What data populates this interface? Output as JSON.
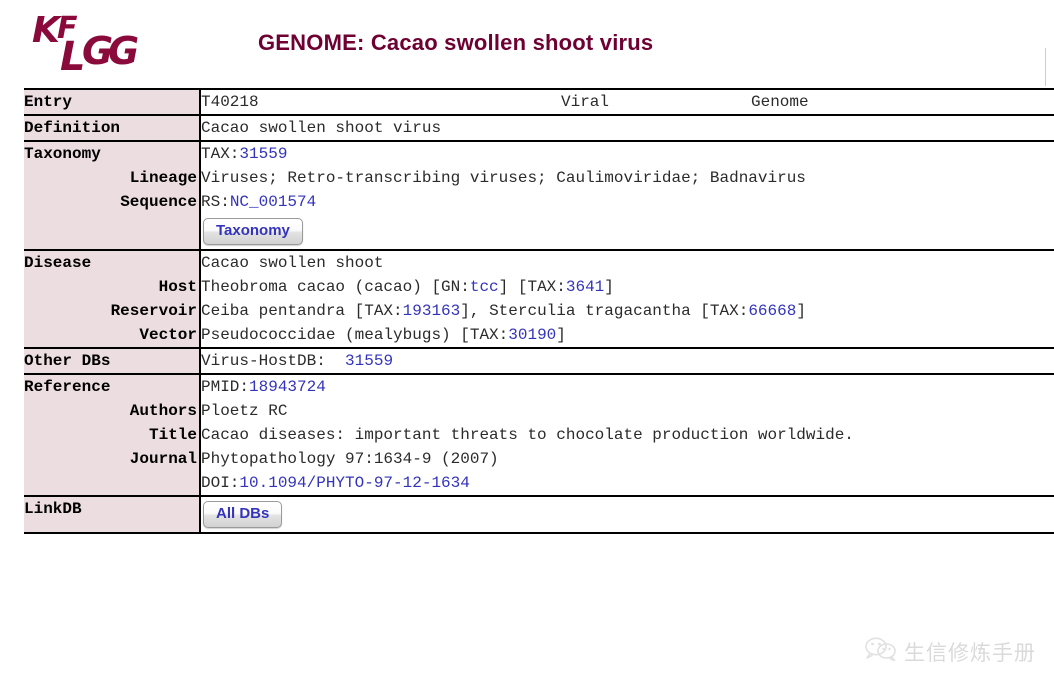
{
  "header": {
    "logo_alt": "KEGG",
    "title": "GENOME: Cacao swollen shoot virus",
    "title_color": "#6e0032",
    "logo_color": "#8b0a3c"
  },
  "colors": {
    "label_background": "#ecdde1",
    "link": "#3333bb",
    "text": "#2b2b2b",
    "rule": "#000000"
  },
  "entry": {
    "label": "Entry",
    "id": "T40218",
    "type": "Viral",
    "kind": "Genome"
  },
  "definition": {
    "label": "Definition",
    "value": "Cacao swollen shoot virus"
  },
  "taxonomy": {
    "label": "Taxonomy",
    "tax_prefix": "TAX:",
    "tax_id": "31559",
    "lineage_label": "Lineage",
    "lineage": "Viruses; Retro-transcribing viruses; Caulimoviridae; Badnavirus",
    "sequence_label": "Sequence",
    "sequence_prefix": "RS:",
    "sequence_id": "NC_001574",
    "button_label": "Taxonomy"
  },
  "disease": {
    "label": "Disease",
    "name": "Cacao swollen shoot",
    "host_label": "Host",
    "host_name": "Theobroma cacao (cacao) ",
    "host_gn_open": "[GN:",
    "host_gn": "tcc",
    "host_gn_close": "] ",
    "host_tax_open": "[TAX:",
    "host_tax": "3641",
    "host_tax_close": "]",
    "reservoir_label": "Reservoir",
    "reservoir_1_name": "Ceiba pentandra ",
    "reservoir_1_tax_open": "[TAX:",
    "reservoir_1_tax": "193163",
    "reservoir_1_tax_close": "], ",
    "reservoir_2_name": "Sterculia tragacantha ",
    "reservoir_2_tax_open": "[TAX:",
    "reservoir_2_tax": "66668",
    "reservoir_2_tax_close": "]",
    "vector_label": "Vector",
    "vector_name": "Pseudococcidae (mealybugs) ",
    "vector_tax_open": "[TAX:",
    "vector_tax": "30190",
    "vector_tax_close": "]"
  },
  "other_dbs": {
    "label": "Other DBs",
    "db_name": "Virus-HostDB:",
    "db_id": "31559"
  },
  "reference": {
    "label": "Reference",
    "pmid_prefix": "PMID:",
    "pmid": "18943724",
    "authors_label": "Authors",
    "authors": "Ploetz RC",
    "title_label": "Title",
    "title": "Cacao diseases: important threats to chocolate production worldwide.",
    "journal_label": "Journal",
    "journal": "Phytopathology 97:1634-9 (2007)",
    "doi_prefix": "DOI:",
    "doi": "10.1094/PHYTO-97-12-1634"
  },
  "linkdb": {
    "label": "LinkDB",
    "button_label": "All DBs"
  },
  "watermark": {
    "icon": "wechat-icon",
    "text": "生信修炼手册"
  }
}
